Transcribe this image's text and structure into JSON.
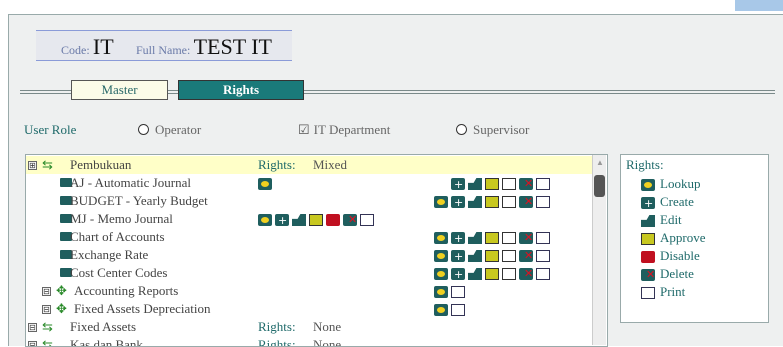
{
  "header": {
    "code_label": "Code:",
    "code_value": "IT",
    "name_label": "Full Name:",
    "name_value": "TEST IT"
  },
  "tabs": [
    {
      "label": "Master",
      "active": false
    },
    {
      "label": "Rights",
      "active": true
    }
  ],
  "user_role": {
    "label": "User Role",
    "options": [
      {
        "label": "Operator",
        "type": "radio"
      },
      {
        "label": "IT Department",
        "type": "check"
      },
      {
        "label": "Supervisor",
        "type": "radio"
      }
    ]
  },
  "tree": {
    "rows": [
      {
        "name": "Pembukuan",
        "rights_label": "Rights:",
        "rights_value": "Mixed",
        "type": "group",
        "expanded": true,
        "expander": "⊞"
      },
      {
        "name": "AJ - Automatic Journal",
        "type": "item",
        "center_icons": [
          "lookup"
        ],
        "right_icons": [
          "create",
          "edit",
          "approve",
          "disable-o",
          "delete",
          "print"
        ]
      },
      {
        "name": "BUDGET - Yearly Budget",
        "type": "item",
        "center_icons": [],
        "right_icons": [
          "lookup",
          "create",
          "edit",
          "approve",
          "disable-o",
          "delete",
          "print"
        ]
      },
      {
        "name": "MJ - Memo Journal",
        "type": "item",
        "center_icons": [
          "lookup",
          "create",
          "edit",
          "approve",
          "disable",
          "delete",
          "print"
        ],
        "right_icons": []
      },
      {
        "name": "Chart of Accounts",
        "type": "item",
        "center_icons": [],
        "right_icons": [
          "lookup",
          "create",
          "edit",
          "approve",
          "disable-o",
          "delete",
          "print"
        ]
      },
      {
        "name": "Exchange Rate",
        "type": "item",
        "center_icons": [],
        "right_icons": [
          "lookup",
          "create",
          "edit",
          "approve",
          "disable-o",
          "delete",
          "print"
        ]
      },
      {
        "name": "Cost Center Codes",
        "type": "item",
        "center_icons": [],
        "right_icons": [
          "lookup",
          "create",
          "edit",
          "approve",
          "disable-o",
          "delete",
          "print"
        ]
      },
      {
        "name": "Accounting Reports",
        "type": "subgroup",
        "expander": "⊟",
        "center_icons": [],
        "right_icons": [
          "lookup",
          "print"
        ]
      },
      {
        "name": "Fixed Assets Depreciation",
        "type": "subgroup",
        "expander": "⊟",
        "center_icons": [],
        "right_icons": [
          "lookup",
          "print"
        ]
      },
      {
        "name": "Fixed Assets",
        "rights_label": "Rights:",
        "rights_value": "None",
        "type": "group",
        "expander": "⊟"
      },
      {
        "name": "Kas dan Bank",
        "rights_label": "Rights:",
        "rights_value": "None",
        "type": "group",
        "expander": "⊟"
      }
    ]
  },
  "legend": {
    "title": "Rights:",
    "items": [
      {
        "label": "Lookup",
        "icon": "lookup"
      },
      {
        "label": "Create",
        "icon": "create"
      },
      {
        "label": "Edit",
        "icon": "edit"
      },
      {
        "label": "Approve",
        "icon": "approve"
      },
      {
        "label": "Disable",
        "icon": "disable"
      },
      {
        "label": "Delete",
        "icon": "delete"
      },
      {
        "label": "Print",
        "icon": "print"
      }
    ]
  },
  "colors": {
    "accent": "#1a7a7a",
    "highlight": "#ffffc8",
    "text_teal": "#1f6a6a"
  }
}
